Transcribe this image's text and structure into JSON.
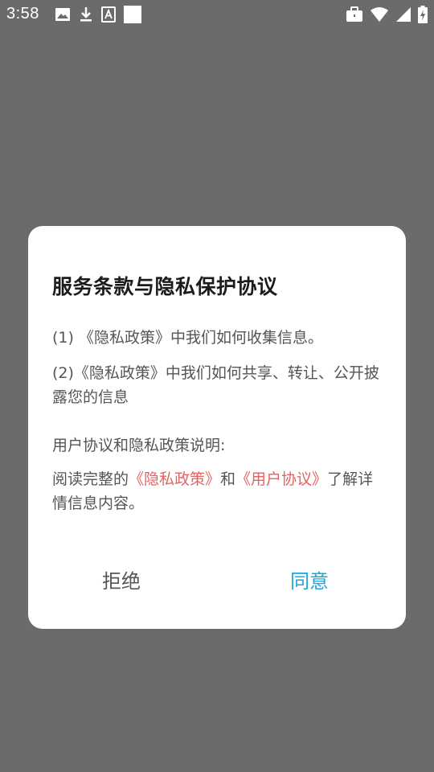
{
  "status_bar": {
    "time": "3:58",
    "left_icons": [
      "image-icon",
      "download-icon",
      "font-icon",
      "square-icon"
    ],
    "right_icons": [
      "briefcase-icon",
      "wifi-icon",
      "signal-icon",
      "battery-charging-icon"
    ]
  },
  "dialog": {
    "title": "服务条款与隐私保护协议",
    "items": [
      "(1) 《隐私政策》中我们如何收集信息。",
      "(2)《隐私政策》中我们如何共享、转让、公开披露您的信息"
    ],
    "section_label": "用户协议和隐私政策说明:",
    "read_prefix": "阅读完整的",
    "privacy_link": "《隐私政策》",
    "and_text": "和",
    "user_link": "《用户协议》",
    "read_suffix": "了解详情信息内容。",
    "reject_label": "拒绝",
    "agree_label": "同意"
  },
  "colors": {
    "overlay": "#6b6b6b",
    "link": "#e06464",
    "agree": "#1aa6e0"
  }
}
